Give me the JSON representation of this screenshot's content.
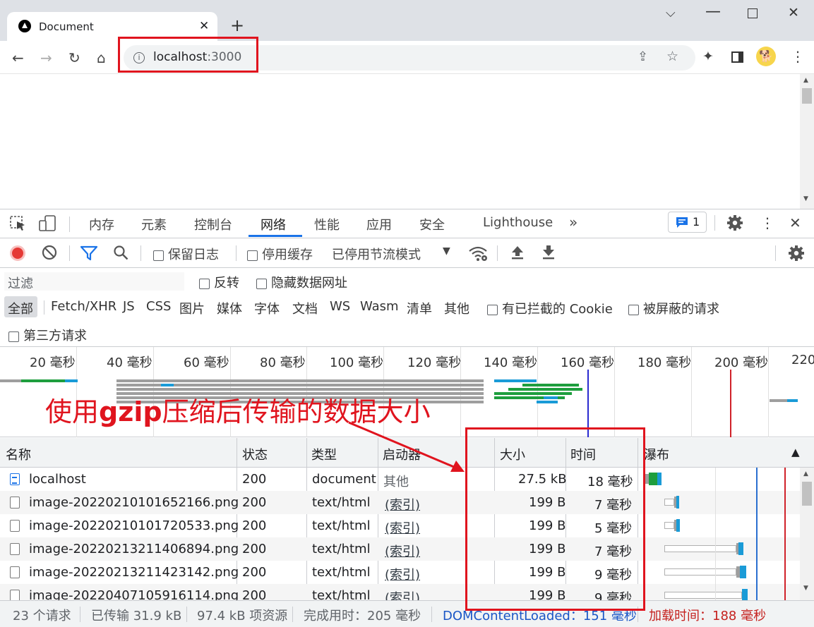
{
  "browser": {
    "tab_title": "Document",
    "address": "localhost",
    "address_port": ":3000"
  },
  "devtools": {
    "tabs": [
      "内存",
      "元素",
      "控制台",
      "网络",
      "性能",
      "应用",
      "安全",
      "Lighthouse"
    ],
    "issues_count": "1",
    "toolbar": {
      "preserve_log": "保留日志",
      "disable_cache": "停用缓存",
      "throttling": "已停用节流模式"
    },
    "filter": {
      "placeholder": "过滤",
      "invert": "反转",
      "hide_data_urls": "隐藏数据网址"
    },
    "types": [
      "全部",
      "Fetch/XHR",
      "JS",
      "CSS",
      "图片",
      "媒体",
      "字体",
      "文档",
      "WS",
      "Wasm",
      "清单",
      "其他"
    ],
    "blocked_cookies": "有已拦截的 Cookie",
    "blocked_requests": "被屏蔽的请求",
    "third_party": "第三方请求",
    "timeline_ticks": [
      "20 毫秒",
      "40 毫秒",
      "60 毫秒",
      "80 毫秒",
      "100 毫秒",
      "120 毫秒",
      "140 毫秒",
      "160 毫秒",
      "180 毫秒",
      "200 毫秒",
      "220"
    ],
    "columns": {
      "name": "名称",
      "status": "状态",
      "type": "类型",
      "initiator": "启动器",
      "size": "大小",
      "time": "时间",
      "waterfall": "瀑布"
    },
    "rows": [
      {
        "name": "localhost",
        "status": "200",
        "type": "document",
        "initiator": "其他",
        "size": "27.5 kB",
        "time": "18 毫秒"
      },
      {
        "name": "image-20220210101652166.png",
        "status": "200",
        "type": "text/html",
        "initiator": "(索引)",
        "size": "199 B",
        "time": "7 毫秒"
      },
      {
        "name": "image-20220210101720533.png",
        "status": "200",
        "type": "text/html",
        "initiator": "(索引)",
        "size": "199 B",
        "time": "5 毫秒"
      },
      {
        "name": "image-20220213211406894.png",
        "status": "200",
        "type": "text/html",
        "initiator": "(索引)",
        "size": "199 B",
        "time": "7 毫秒"
      },
      {
        "name": "image-20220213211423142.png",
        "status": "200",
        "type": "text/html",
        "initiator": "(索引)",
        "size": "199 B",
        "time": "9 毫秒"
      },
      {
        "name": "image-20220407105916114.png",
        "status": "200",
        "type": "text/html",
        "initiator": "(索引)",
        "size": "199 B",
        "time": "9 毫秒"
      }
    ],
    "status_bar": {
      "requests": "23 个请求",
      "transferred": "已传输 31.9 kB",
      "resources": "97.4 kB 项资源",
      "finish": "完成用时：205 毫秒",
      "dcl": "DOMContentLoaded：151 毫秒",
      "load": "加载时间：188 毫秒"
    }
  },
  "annotation": {
    "prefix": "使用",
    "bold": "gzip",
    "suffix": "压缩后传输的数据大小"
  },
  "colors": {
    "annotation_red": "#e0141e",
    "dcl_blue": "#1a73e8",
    "load_red": "#c5221f",
    "record_red": "#e53935"
  }
}
